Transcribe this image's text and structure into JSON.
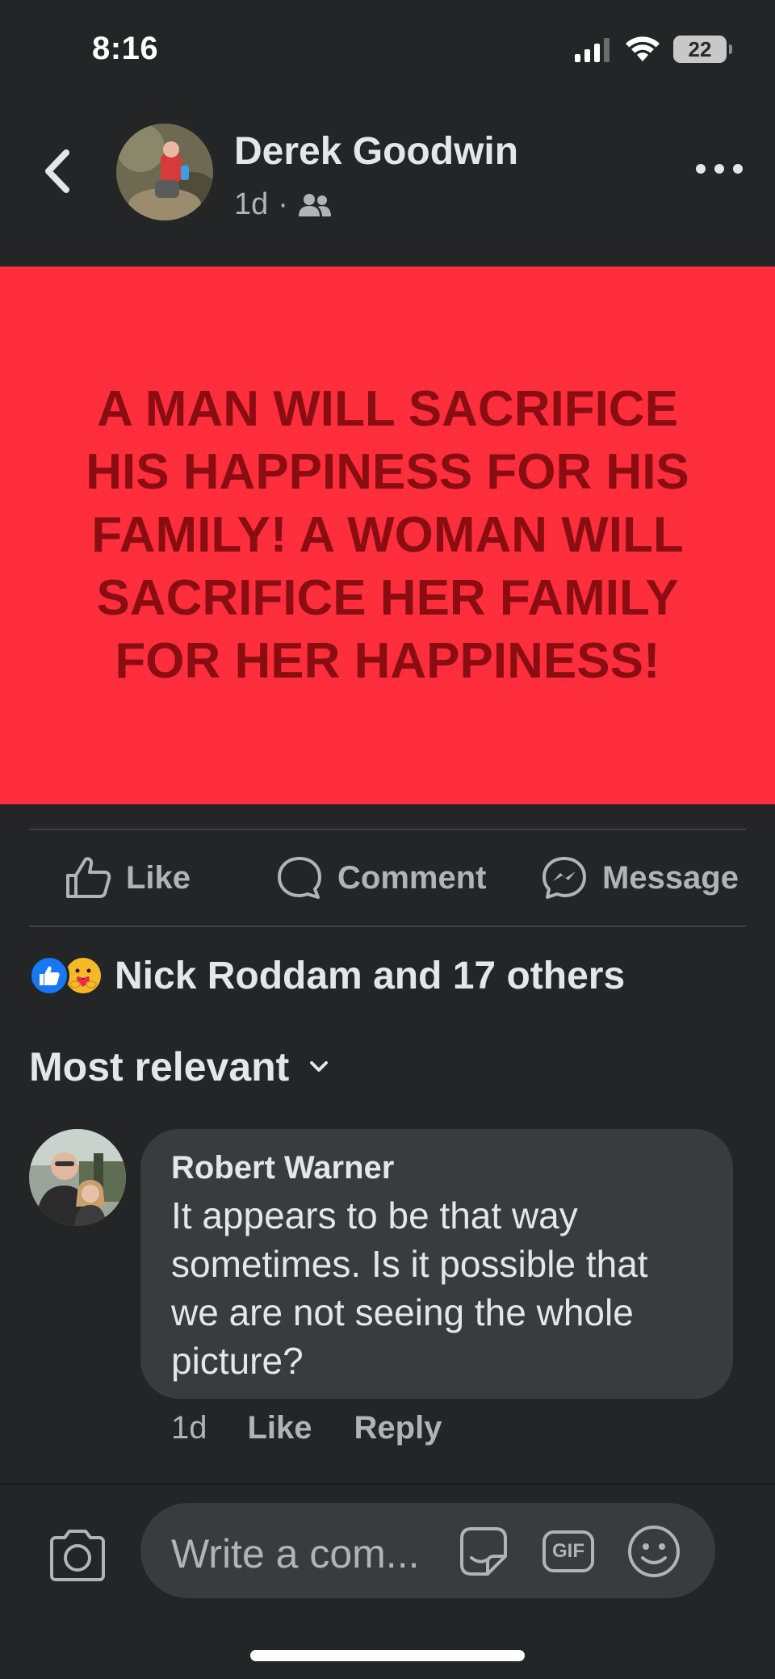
{
  "status_bar": {
    "time": "8:16",
    "battery": "22"
  },
  "post": {
    "author": "Derek Goodwin",
    "time": "1d",
    "separator": "·",
    "audience_icon": "friends-icon",
    "text": "A MAN WILL SACRIFICE HIS HAPPINESS FOR HIS FAMILY! A WOMAN WILL SACRIFICE HER FAMILY FOR HER HAPPINESS!",
    "background_color": "#fe2e3c",
    "text_color": "#8a0d12"
  },
  "actions": {
    "like": "Like",
    "comment": "Comment",
    "message": "Message"
  },
  "reactions": {
    "summary": "Nick Roddam and 17 others",
    "icons": [
      "like-reaction-icon",
      "care-reaction-icon"
    ]
  },
  "sort": {
    "label": "Most relevant"
  },
  "comments": [
    {
      "author": "Robert Warner",
      "text": "It appears to be that way sometimes. Is it possible that we are not seeing the whole picture?",
      "time": "1d",
      "like_label": "Like",
      "reply_label": "Reply"
    }
  ],
  "composer": {
    "placeholder": "Write a com...",
    "gif_label": "GIF"
  },
  "colors": {
    "background": "#242526",
    "accent": "#1877f2",
    "bubble": "#3a3b3c",
    "secondary_text": "#b0b3b8"
  }
}
